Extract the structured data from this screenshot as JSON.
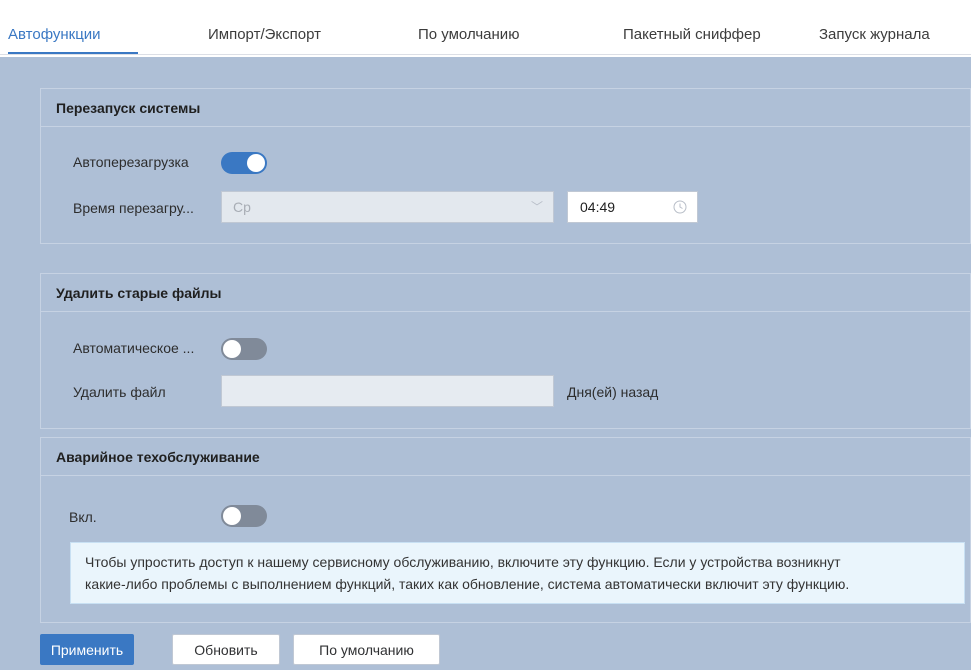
{
  "tabs": [
    {
      "label": "Автофункции",
      "active": true
    },
    {
      "label": "Импорт/Экспорт",
      "active": false
    },
    {
      "label": "По умолчанию",
      "active": false
    },
    {
      "label": "Пакетный сниффер",
      "active": false
    },
    {
      "label": "Запуск журнала",
      "active": false
    }
  ],
  "restart": {
    "title": "Перезапуск системы",
    "auto_label": "Автоперезагрузка",
    "auto_enabled": true,
    "time_label": "Время перезагру...",
    "day_value": "Ср",
    "time_value": "04:49"
  },
  "delete_old": {
    "title": "Удалить старые файлы",
    "auto_label": "Автоматическое ...",
    "auto_enabled": false,
    "delete_label": "Удалить файл",
    "days_value": "",
    "days_suffix": "Дня(ей) назад"
  },
  "emergency": {
    "title": "Аварийное техобслуживание",
    "on_label": "Вкл.",
    "enabled": false,
    "notice_line1": "Чтобы упростить доступ к нашему сервисному обслуживанию, включите эту функцию. Если у устройства возникнут",
    "notice_line2": "какие-либо проблемы с выполнением функций, таких как обновление, система автоматически включит эту функцию."
  },
  "buttons": {
    "apply": "Применить",
    "refresh": "Обновить",
    "default": "По умолчанию"
  },
  "colors": {
    "accent": "#3a78c3",
    "content_bg": "#aebfd6",
    "notice_bg": "#eaf5fc"
  }
}
